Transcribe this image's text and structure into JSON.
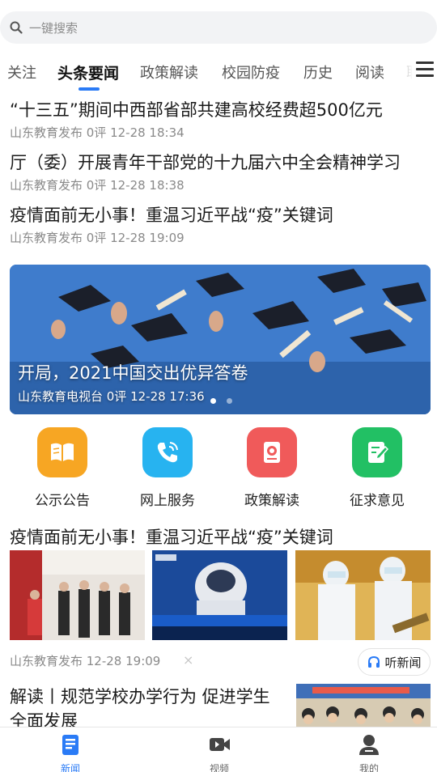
{
  "search": {
    "placeholder": "一键搜索"
  },
  "tabs": [
    {
      "label": "关注"
    },
    {
      "label": "头条要闻"
    },
    {
      "label": "政策解读"
    },
    {
      "label": "校园防疫"
    },
    {
      "label": "历史"
    },
    {
      "label": "阅读"
    },
    {
      "label": "职"
    }
  ],
  "news": [
    {
      "title": "“十三五”期间中西部省部共建高校经费超500亿元",
      "meta": "山东教育发布 0评 12-28 18:34"
    },
    {
      "title": "厅（委）开展青年干部党的十九届六中全会精神学习",
      "meta": "山东教育发布 0评 12-28 18:38"
    },
    {
      "title": "疫情面前无小事！重温习近平战“疫”关键词",
      "meta": "山东教育发布 0评 12-28 19:09"
    }
  ],
  "banner": {
    "title": "开局，2021中国交出优异答卷",
    "meta": "山东教育电视台 0评 12-28 17:36"
  },
  "quick_links": [
    {
      "label": "公示公告",
      "color": "#f7a623",
      "icon": "book-icon"
    },
    {
      "label": "网上服务",
      "color": "#27b3f0",
      "icon": "phone-icon"
    },
    {
      "label": "政策解读",
      "color": "#f05a5a",
      "icon": "document-icon"
    },
    {
      "label": "征求意见",
      "color": "#22c064",
      "icon": "edit-icon"
    }
  ],
  "featured": {
    "title": "疫情面前无小事！重温习近平战“疫”关键词",
    "meta": "山东教育发布 12-28 19:09",
    "listen_label": "听新闻",
    "close": "×"
  },
  "last": {
    "title": "解读丨规范学校办学行为 促进学生全面发展"
  },
  "bottom_nav": [
    {
      "label": "新闻"
    },
    {
      "label": "视频"
    },
    {
      "label": "我的"
    }
  ],
  "colors": {
    "accent": "#2a7bf6"
  }
}
